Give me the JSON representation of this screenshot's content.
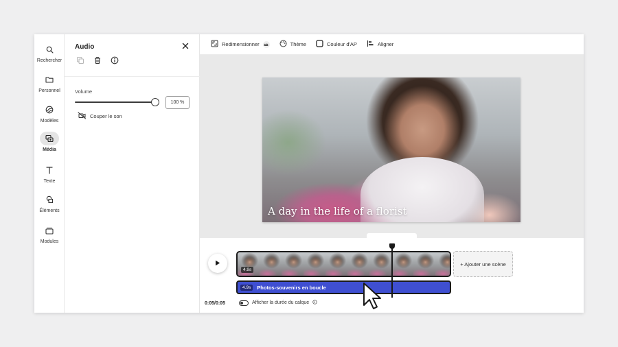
{
  "rail": {
    "items": [
      {
        "label": "Rechercher",
        "icon": "search-icon"
      },
      {
        "label": "Personnel",
        "icon": "folder-icon"
      },
      {
        "label": "Modèles",
        "icon": "templates-icon"
      },
      {
        "label": "Média",
        "icon": "media-icon",
        "active": true
      },
      {
        "label": "Texte",
        "icon": "text-icon"
      },
      {
        "label": "Éléments",
        "icon": "shapes-icon"
      },
      {
        "label": "Modules",
        "icon": "modules-icon"
      }
    ]
  },
  "panel": {
    "title": "Audio",
    "volume_label": "Volume",
    "volume_value": "100 %",
    "volume_level": 1.0,
    "mute_label": "Couper le son"
  },
  "toolbar": {
    "resize_label": "Redimensionner",
    "theme_label": "Thème",
    "color_label": "Couleur d'AP",
    "align_label": "Aligner"
  },
  "canvas": {
    "caption": "A day in the life of a florist"
  },
  "timeline": {
    "video_duration": "4.9s",
    "audio_duration": "4.9s",
    "audio_label": "Photos-souvenirs en boucle",
    "add_scene_label": "+ Ajouter une scène",
    "time_display": "0:05/0:05",
    "layer_toggle_label": "Afficher la durée du calque"
  },
  "colors": {
    "audio_track": "#3f4fd1",
    "active_rail_bg": "#e4e4e4"
  }
}
